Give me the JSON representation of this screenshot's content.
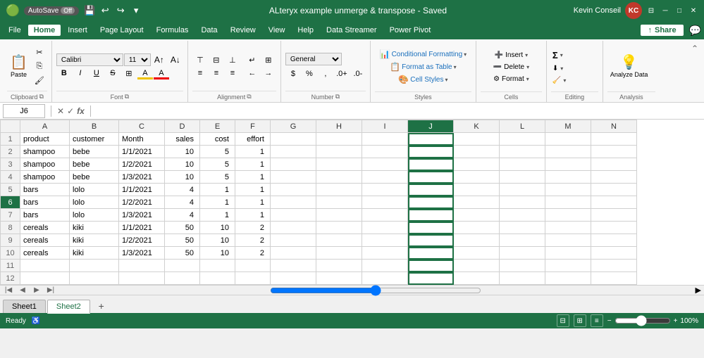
{
  "titleBar": {
    "autosaveLabel": "AutoSave",
    "autosaveState": "Off",
    "titleText": "ALteryx example unmerge & transpose - Saved",
    "userLabel": "Kevin Conseil",
    "userInitials": "KC"
  },
  "menuBar": {
    "items": [
      "File",
      "Home",
      "Insert",
      "Page Layout",
      "Formulas",
      "Data",
      "Review",
      "View",
      "Help",
      "Data Streamer",
      "Power Pivot"
    ],
    "activeItem": "Home",
    "shareLabel": "Share"
  },
  "ribbon": {
    "clipboard": {
      "pasteLabel": "Paste",
      "groupLabel": "Clipboard"
    },
    "font": {
      "fontName": "Calibri",
      "fontSize": "11",
      "groupLabel": "Font"
    },
    "alignment": {
      "groupLabel": "Alignment"
    },
    "number": {
      "format": "General",
      "groupLabel": "Number"
    },
    "styles": {
      "conditionalFormatting": "Conditional Formatting",
      "formatAsTable": "Format as Table",
      "cellStyles": "Cell Styles",
      "groupLabel": "Styles"
    },
    "cells": {
      "insert": "Insert",
      "delete": "Delete",
      "format": "Format",
      "groupLabel": "Cells"
    },
    "editing": {
      "groupLabel": "Editing"
    },
    "analysis": {
      "analyzeData": "Analyze Data",
      "groupLabel": "Analysis"
    }
  },
  "formulaBar": {
    "cellRef": "J6",
    "formula": ""
  },
  "grid": {
    "columns": [
      "A",
      "B",
      "C",
      "D",
      "E",
      "F",
      "G",
      "H",
      "I",
      "J",
      "K",
      "L",
      "M",
      "N"
    ],
    "rows": [
      {
        "id": 1,
        "cells": [
          "product",
          "customer",
          "Month",
          "sales",
          "cost",
          "effort",
          "",
          "",
          "",
          "",
          "",
          "",
          "",
          ""
        ]
      },
      {
        "id": 2,
        "cells": [
          "shampoo",
          "bebe",
          "1/1/2021",
          "10",
          "5",
          "1",
          "",
          "",
          "",
          "",
          "",
          "",
          "",
          ""
        ]
      },
      {
        "id": 3,
        "cells": [
          "shampoo",
          "bebe",
          "1/2/2021",
          "10",
          "5",
          "1",
          "",
          "",
          "",
          "",
          "",
          "",
          "",
          ""
        ]
      },
      {
        "id": 4,
        "cells": [
          "shampoo",
          "bebe",
          "1/3/2021",
          "10",
          "5",
          "1",
          "",
          "",
          "",
          "",
          "",
          "",
          "",
          ""
        ]
      },
      {
        "id": 5,
        "cells": [
          "bars",
          "lolo",
          "1/1/2021",
          "4",
          "1",
          "1",
          "",
          "",
          "",
          "",
          "",
          "",
          "",
          ""
        ]
      },
      {
        "id": 6,
        "cells": [
          "bars",
          "lolo",
          "1/2/2021",
          "4",
          "1",
          "1",
          "",
          "",
          "",
          "",
          "",
          "",
          "",
          ""
        ]
      },
      {
        "id": 7,
        "cells": [
          "bars",
          "lolo",
          "1/3/2021",
          "4",
          "1",
          "1",
          "",
          "",
          "",
          "",
          "",
          "",
          "",
          ""
        ]
      },
      {
        "id": 8,
        "cells": [
          "cereals",
          "kiki",
          "1/1/2021",
          "50",
          "10",
          "2",
          "",
          "",
          "",
          "",
          "",
          "",
          "",
          ""
        ]
      },
      {
        "id": 9,
        "cells": [
          "cereals",
          "kiki",
          "1/2/2021",
          "50",
          "10",
          "2",
          "",
          "",
          "",
          "",
          "",
          "",
          "",
          ""
        ]
      },
      {
        "id": 10,
        "cells": [
          "cereals",
          "kiki",
          "1/3/2021",
          "50",
          "10",
          "2",
          "",
          "",
          "",
          "",
          "",
          "",
          "",
          ""
        ]
      },
      {
        "id": 11,
        "cells": [
          "",
          "",
          "",
          "",
          "",
          "",
          "",
          "",
          "",
          "",
          "",
          "",
          "",
          ""
        ]
      },
      {
        "id": 12,
        "cells": [
          "",
          "",
          "",
          "",
          "",
          "",
          "",
          "",
          "",
          "",
          "",
          "",
          "",
          ""
        ]
      }
    ],
    "selectedCell": {
      "row": 6,
      "col": "J"
    },
    "selectedColIndex": 9
  },
  "sheetTabs": {
    "tabs": [
      "Sheet1",
      "Sheet2"
    ],
    "activeTab": "Sheet2"
  },
  "statusBar": {
    "readyLabel": "Ready",
    "zoom": "100%",
    "zoomValue": 100
  }
}
